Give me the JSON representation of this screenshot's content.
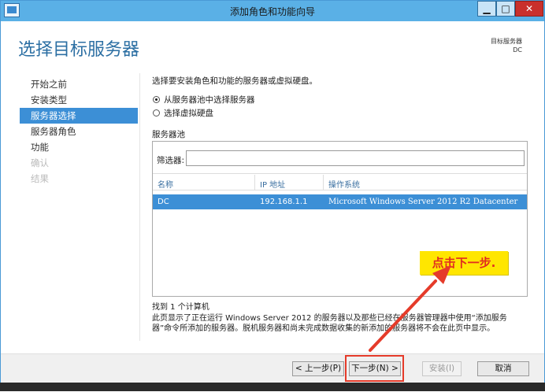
{
  "window": {
    "title": "添加角色和功能向导",
    "minimize_glyph": "▁",
    "maximize_glyph": "□",
    "close_glyph": "✕"
  },
  "header": {
    "page_title": "选择目标服务器",
    "destination_label": "目标服务器",
    "destination_value": "DC"
  },
  "nav": {
    "items": [
      {
        "label": "开始之前",
        "state": "normal"
      },
      {
        "label": "安装类型",
        "state": "normal"
      },
      {
        "label": "服务器选择",
        "state": "active"
      },
      {
        "label": "服务器角色",
        "state": "normal"
      },
      {
        "label": "功能",
        "state": "normal"
      },
      {
        "label": "确认",
        "state": "disabled"
      },
      {
        "label": "结果",
        "state": "disabled"
      }
    ]
  },
  "content": {
    "intro": "选择要安装角色和功能的服务器或虚拟硬盘。",
    "options": [
      {
        "label": "从服务器池中选择服务器",
        "checked": true
      },
      {
        "label": "选择虚拟硬盘",
        "checked": false
      }
    ],
    "pool_title": "服务器池",
    "filter_label": "筛选器:",
    "filter_value": "",
    "columns": [
      "名称",
      "IP 地址",
      "操作系统"
    ],
    "rows": [
      {
        "name": "DC",
        "ip": "192.168.1.1",
        "os": "Microsoft Windows Server 2012 R2 Datacenter",
        "selected": true
      }
    ],
    "found_text": "找到 1 个计算机",
    "note": "此页显示了正在运行 Windows Server 2012 的服务器以及那些已经在服务器管理器中使用“添加服务器”命令所添加的服务器。脱机服务器和尚未完成数据收集的新添加的服务器将不会在此页中显示。"
  },
  "footer": {
    "prev_label": "< 上一步(P)",
    "next_label": "下一步(N) >",
    "install_label": "安装(I)",
    "cancel_label": "取消"
  },
  "annotation": {
    "callout_text": "点击下一步.",
    "callout_bg": "#ffe600",
    "callout_color": "#e12d20",
    "arrow_color": "#e53b2a"
  },
  "colors": {
    "accent": "#3c8fd6",
    "titlebar": "#5ab0e6",
    "heading": "#2c6fa3"
  }
}
